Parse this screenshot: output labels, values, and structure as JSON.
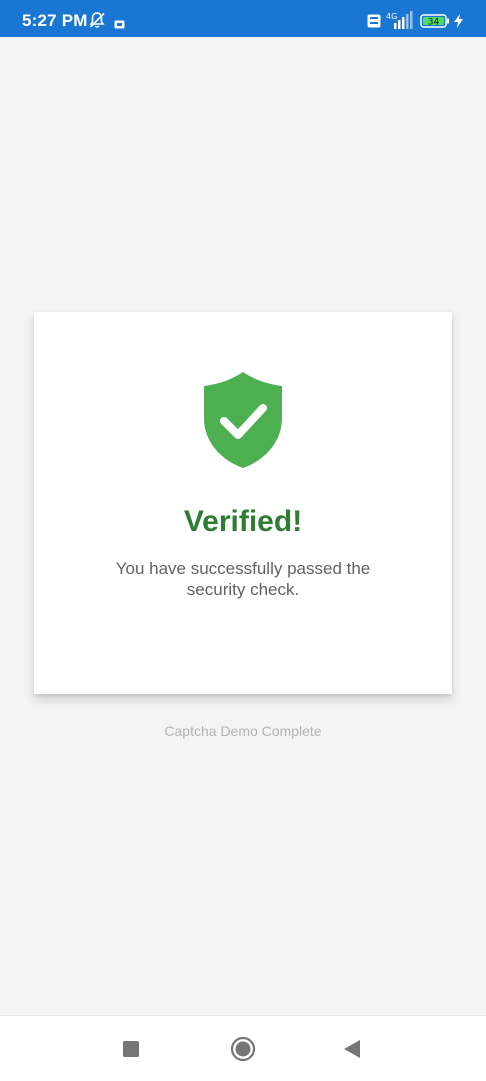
{
  "status_bar": {
    "time": "5:27 PM",
    "network": "4G",
    "battery": "34",
    "icons": [
      "mute-icon",
      "notification-icon",
      "volte-icon",
      "signal-icon",
      "battery-icon",
      "charging-icon"
    ]
  },
  "card": {
    "icon": "shield-check-icon",
    "title": "Verified!",
    "message": "You have successfully passed the security check."
  },
  "footer": {
    "text": "Captcha Demo Complete"
  },
  "nav_bar": {
    "buttons": [
      "recents-button",
      "home-button",
      "back-button"
    ]
  },
  "colors": {
    "status_bar": "#1976d2",
    "background": "#f4f4f4",
    "shield": "#4caf50",
    "title": "#2e7d32",
    "message": "#616161",
    "footer": "#b3b3b3"
  }
}
